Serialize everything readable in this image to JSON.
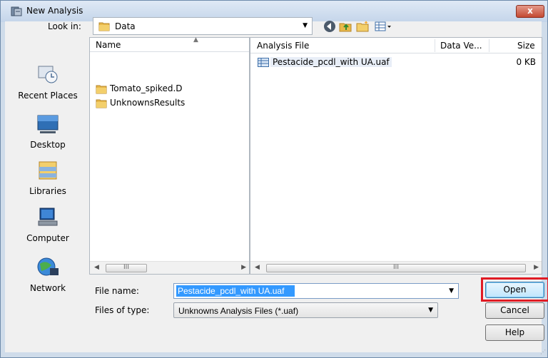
{
  "window": {
    "title": "New Analysis",
    "close_label": "x"
  },
  "look_in": {
    "label": "Look in:",
    "value": "Data"
  },
  "toolbar": {
    "icons": [
      "back-icon",
      "up-folder-icon",
      "new-folder-icon",
      "views-menu-icon"
    ]
  },
  "places": [
    {
      "label": "Recent Places",
      "icon": "recent-places-icon"
    },
    {
      "label": "Desktop",
      "icon": "desktop-icon"
    },
    {
      "label": "Libraries",
      "icon": "libraries-icon"
    },
    {
      "label": "Computer",
      "icon": "computer-icon"
    },
    {
      "label": "Network",
      "icon": "network-icon"
    }
  ],
  "name_list": {
    "header": "Name",
    "items": [
      "Tomato_spiked.D",
      "UnknownsResults"
    ]
  },
  "details": {
    "columns": [
      "Analysis File",
      "Data Ve...",
      "Size"
    ],
    "rows": [
      {
        "name": "Pestacide_pcdl_with UA.uaf",
        "data_version": "",
        "size": "0 KB"
      }
    ]
  },
  "scrollbar_thumb_glyph": "III",
  "file_name": {
    "label": "File name:",
    "value": "Pestacide_pcdl_with UA.uaf"
  },
  "file_type": {
    "label": "Files of type:",
    "value": "Unknowns Analysis Files (*.uaf)"
  },
  "buttons": {
    "open": "Open",
    "cancel": "Cancel",
    "help": "Help"
  },
  "colors": {
    "selection": "#3399ff",
    "highlight_box": "#e01b24",
    "titlebar": "#c4d5ea",
    "close": "#c44a32"
  }
}
